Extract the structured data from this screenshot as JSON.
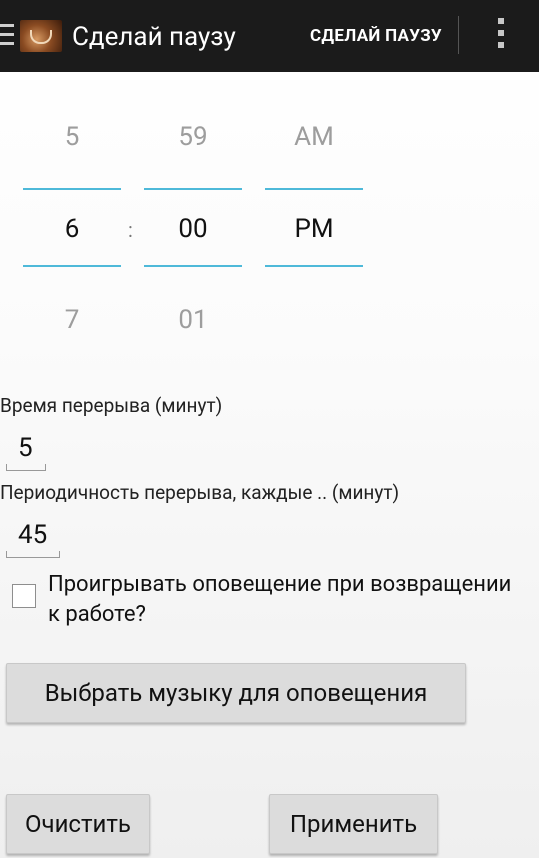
{
  "actionbar": {
    "title": "Сделай паузу",
    "action_label": "СДЕЛАЙ ПАУЗУ",
    "menu_icon": "hamburger-icon",
    "app_icon": "coffee-cup-icon",
    "overflow_icon": "more-vertical-icon"
  },
  "time_picker": {
    "hour": {
      "prev": "5",
      "current": "6",
      "next": "7"
    },
    "minute": {
      "prev": "59",
      "current": "00",
      "next": "01"
    },
    "ampm": {
      "prev": "AM",
      "current": "PM"
    },
    "separator": ":"
  },
  "break_duration": {
    "label": "Время перерыва (минут)",
    "value": "5"
  },
  "break_interval": {
    "label": "Периодичность перерыва, каждые .. (минут)",
    "value": "45"
  },
  "notify_checkbox": {
    "label": "Проигрывать оповещение при возвращении к работе?",
    "checked": false
  },
  "buttons": {
    "choose_music": "Выбрать музыку для оповещения",
    "clear": "Очистить",
    "apply": "Применить"
  },
  "colors": {
    "accent": "#4eb9d9",
    "actionbar_bg": "#1b1b1b"
  }
}
